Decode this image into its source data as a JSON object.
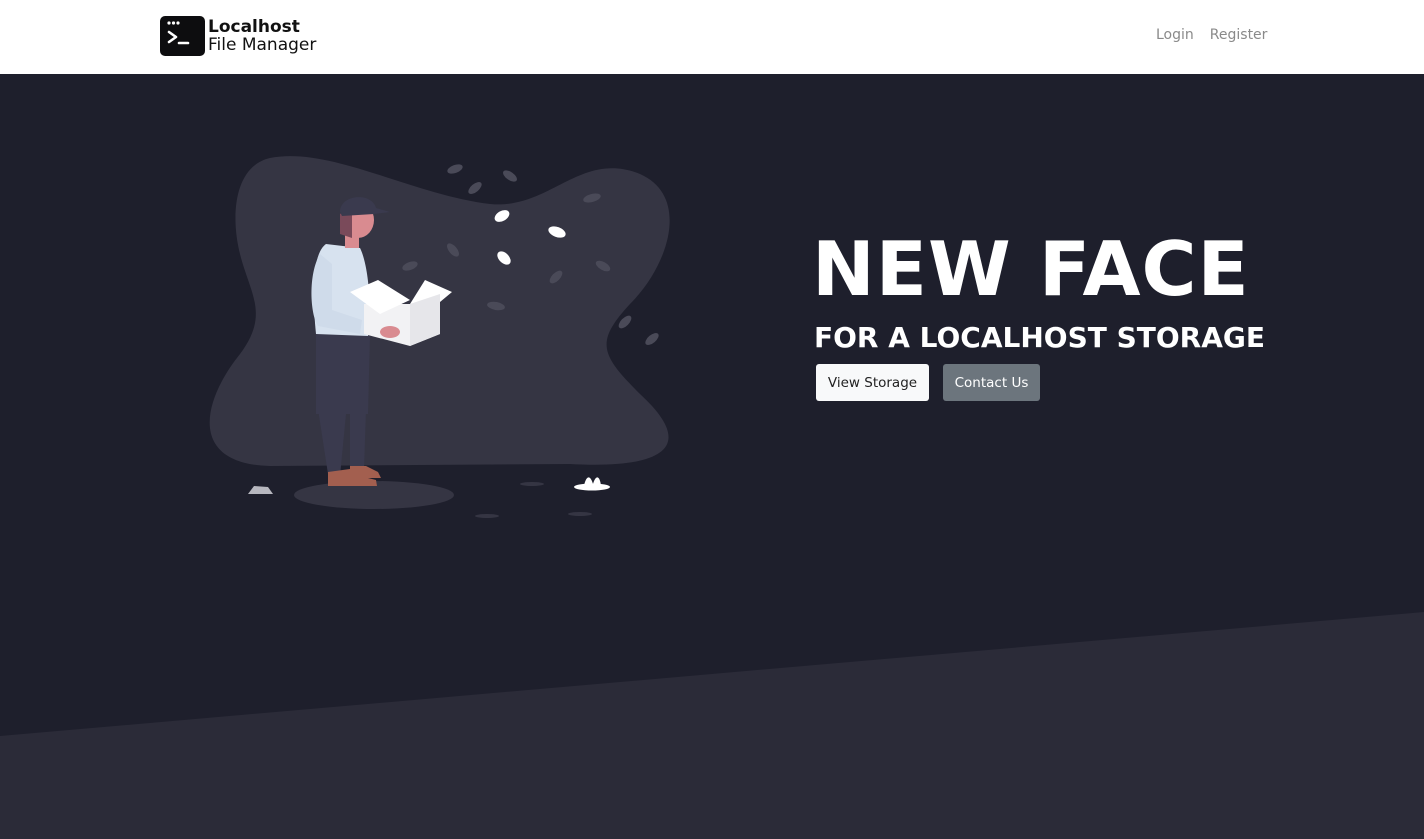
{
  "brand": {
    "line1": "Localhost",
    "line2": "File Manager",
    "icon": "terminal-icon"
  },
  "nav": {
    "login": "Login",
    "register": "Register"
  },
  "hero": {
    "headline": "NEW FACE",
    "subline": "FOR A LOCALHOST STORAGE",
    "view_storage": "View Storage",
    "contact_us": "Contact Us",
    "illustration": "person-with-box-illustration"
  },
  "colors": {
    "navbar_bg": "#ffffff",
    "hero_bg": "#1e1f2c",
    "lower_bg": "#2b2b38",
    "blob": "#353543",
    "btn_light": "#f8f9fa",
    "btn_secondary": "#6c757d"
  }
}
